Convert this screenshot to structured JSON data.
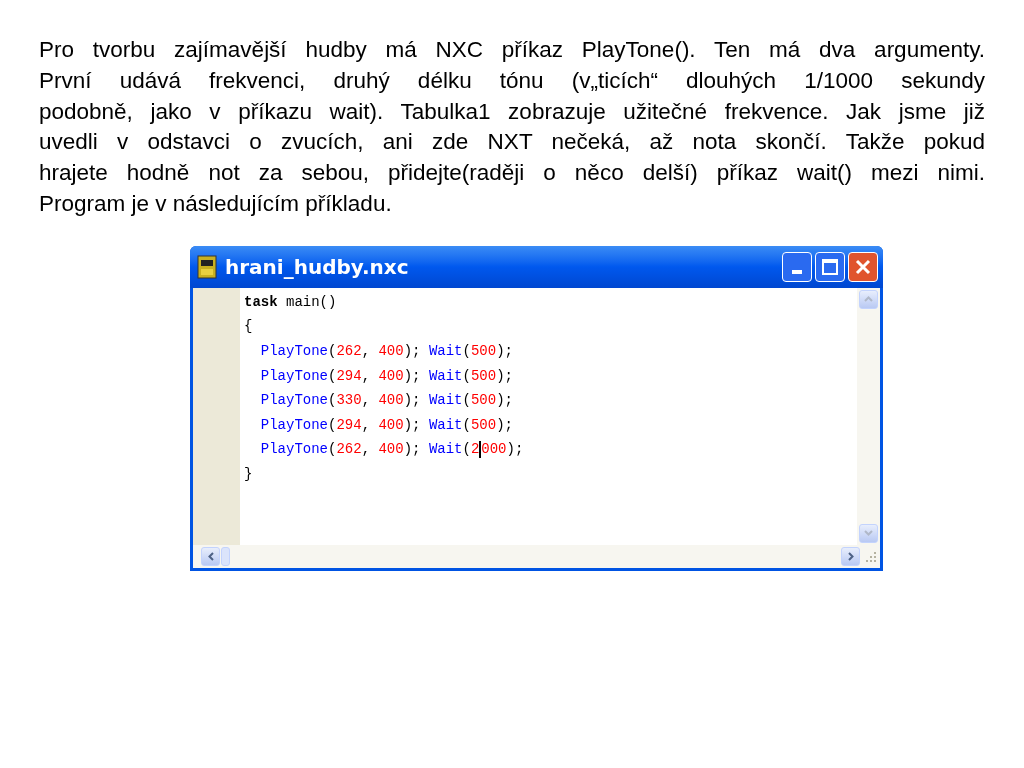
{
  "paragraph_lines": [
    "Pro tvorbu zajímavější hudby má NXC příkaz PlayTone(). Ten má dva argumenty.",
    "První udává frekvenci, druhý délku tónu (v„ticích“ dlouhých 1/1000 sekundy",
    "podobně, jako v příkazu wait). Tabulka1 zobrazuje užitečné frekvence. Jak jsme již",
    "uvedli v odstavci o zvucích, ani zde NXT nečeká, až nota skončí. Takže pokud",
    "hrajete hodně not za sebou, přidejte(raději o něco delší) příkaz wait() mezi nimi.",
    "Program je v následujícím příkladu."
  ],
  "window": {
    "title": "hrani_hudby.nxc",
    "code_lines": [
      {
        "tokens": [
          {
            "kind": "keyword",
            "text": "task"
          },
          {
            "kind": "plain",
            "text": " main()"
          }
        ]
      },
      {
        "tokens": [
          {
            "kind": "plain",
            "text": "{"
          }
        ]
      },
      {
        "tokens": [
          {
            "kind": "func",
            "text": "  PlayTone"
          },
          {
            "kind": "plain",
            "text": "("
          },
          {
            "kind": "number",
            "text": "262"
          },
          {
            "kind": "plain",
            "text": ", "
          },
          {
            "kind": "number",
            "text": "400"
          },
          {
            "kind": "plain",
            "text": "); "
          },
          {
            "kind": "func",
            "text": "Wait"
          },
          {
            "kind": "plain",
            "text": "("
          },
          {
            "kind": "number",
            "text": "500"
          },
          {
            "kind": "plain",
            "text": ");"
          }
        ]
      },
      {
        "tokens": [
          {
            "kind": "func",
            "text": "  PlayTone"
          },
          {
            "kind": "plain",
            "text": "("
          },
          {
            "kind": "number",
            "text": "294"
          },
          {
            "kind": "plain",
            "text": ", "
          },
          {
            "kind": "number",
            "text": "400"
          },
          {
            "kind": "plain",
            "text": "); "
          },
          {
            "kind": "func",
            "text": "Wait"
          },
          {
            "kind": "plain",
            "text": "("
          },
          {
            "kind": "number",
            "text": "500"
          },
          {
            "kind": "plain",
            "text": ");"
          }
        ]
      },
      {
        "tokens": [
          {
            "kind": "func",
            "text": "  PlayTone"
          },
          {
            "kind": "plain",
            "text": "("
          },
          {
            "kind": "number",
            "text": "330"
          },
          {
            "kind": "plain",
            "text": ", "
          },
          {
            "kind": "number",
            "text": "400"
          },
          {
            "kind": "plain",
            "text": "); "
          },
          {
            "kind": "func",
            "text": "Wait"
          },
          {
            "kind": "plain",
            "text": "("
          },
          {
            "kind": "number",
            "text": "500"
          },
          {
            "kind": "plain",
            "text": ");"
          }
        ]
      },
      {
        "tokens": [
          {
            "kind": "func",
            "text": "  PlayTone"
          },
          {
            "kind": "plain",
            "text": "("
          },
          {
            "kind": "number",
            "text": "294"
          },
          {
            "kind": "plain",
            "text": ", "
          },
          {
            "kind": "number",
            "text": "400"
          },
          {
            "kind": "plain",
            "text": "); "
          },
          {
            "kind": "func",
            "text": "Wait"
          },
          {
            "kind": "plain",
            "text": "("
          },
          {
            "kind": "number",
            "text": "500"
          },
          {
            "kind": "plain",
            "text": ");"
          }
        ]
      },
      {
        "tokens": [
          {
            "kind": "func",
            "text": "  PlayTone"
          },
          {
            "kind": "plain",
            "text": "("
          },
          {
            "kind": "number",
            "text": "262"
          },
          {
            "kind": "plain",
            "text": ", "
          },
          {
            "kind": "number",
            "text": "400"
          },
          {
            "kind": "plain",
            "text": "); "
          },
          {
            "kind": "func",
            "text": "Wait"
          },
          {
            "kind": "plain",
            "text": "("
          },
          {
            "kind": "number",
            "text": "2"
          },
          {
            "kind": "caret"
          },
          {
            "kind": "number",
            "text": "000"
          },
          {
            "kind": "plain",
            "text": ");"
          }
        ]
      },
      {
        "tokens": [
          {
            "kind": "plain",
            "text": "}"
          }
        ]
      }
    ]
  }
}
